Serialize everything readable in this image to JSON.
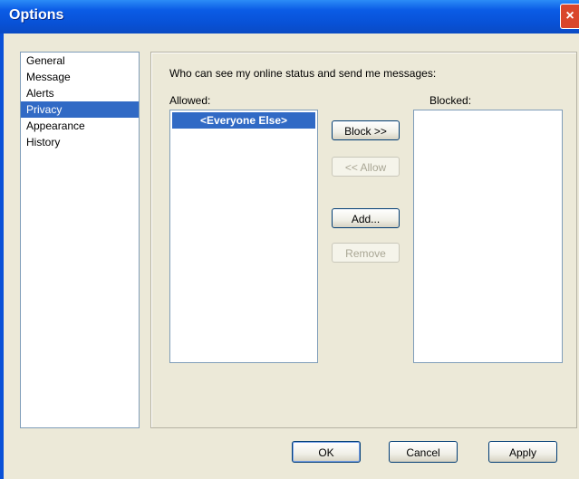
{
  "window": {
    "title": "Options",
    "close_symbol": "×"
  },
  "nav": {
    "items": [
      "General",
      "Message",
      "Alerts",
      "Privacy",
      "Appearance",
      "History"
    ],
    "selected_index": 3
  },
  "privacy": {
    "description": "Who can see my online status and send me messages:",
    "allowed_label": "Allowed:",
    "blocked_label": "Blocked:",
    "allowed_items": [
      "<Everyone Else>"
    ],
    "blocked_items": []
  },
  "buttons": {
    "block": "Block >>",
    "allow": "<< Allow",
    "add": "Add...",
    "remove": "Remove",
    "ok": "OK",
    "cancel": "Cancel",
    "apply": "Apply"
  },
  "colors": {
    "titlebar": "#0b5ce6",
    "selection": "#316ac5",
    "dialog_bg": "#ece9d8"
  }
}
